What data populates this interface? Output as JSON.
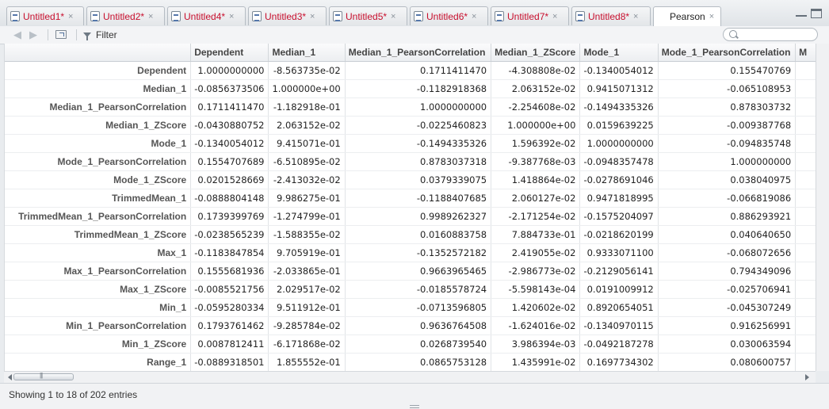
{
  "tabs": [
    {
      "label": "Untitled1*",
      "active": false
    },
    {
      "label": "Untitled2*",
      "active": false
    },
    {
      "label": "Untitled4*",
      "active": false
    },
    {
      "label": "Untitled3*",
      "active": false
    },
    {
      "label": "Untitled5*",
      "active": false
    },
    {
      "label": "Untitled6*",
      "active": false
    },
    {
      "label": "Untitled7*",
      "active": false
    },
    {
      "label": "Untitled8*",
      "active": false
    },
    {
      "label": "Pearson",
      "active": true
    }
  ],
  "tab_close_glyph": "×",
  "toolbar": {
    "back_icon": "arrow-left-icon",
    "forward_icon": "arrow-right-icon",
    "popout_icon": "show-in-new-window-icon",
    "filter_icon": "funnel-icon",
    "filter_label": "Filter",
    "search_placeholder": "",
    "search_value": ""
  },
  "table": {
    "columns": [
      "",
      "Dependent",
      "Median_1",
      "Median_1_PearsonCorrelation",
      "Median_1_ZScore",
      "Mode_1",
      "Mode_1_PearsonCorrelation",
      "M"
    ],
    "rows": [
      [
        "Dependent",
        "1.0000000000",
        "-8.563735e-02",
        "0.1711411470",
        "-4.308808e-02",
        "-0.1340054012",
        "0.155470769"
      ],
      [
        "Median_1",
        "-0.0856373506",
        "1.000000e+00",
        "-0.1182918368",
        "2.063152e-02",
        "0.9415071312",
        "-0.065108953"
      ],
      [
        "Median_1_PearsonCorrelation",
        "0.1711411470",
        "-1.182918e-01",
        "1.0000000000",
        "-2.254608e-02",
        "-0.1494335326",
        "0.878303732"
      ],
      [
        "Median_1_ZScore",
        "-0.0430880752",
        "2.063152e-02",
        "-0.0225460823",
        "1.000000e+00",
        "0.0159639225",
        "-0.009387768"
      ],
      [
        "Mode_1",
        "-0.1340054012",
        "9.415071e-01",
        "-0.1494335326",
        "1.596392e-02",
        "1.0000000000",
        "-0.094835748"
      ],
      [
        "Mode_1_PearsonCorrelation",
        "0.1554707689",
        "-6.510895e-02",
        "0.8783037318",
        "-9.387768e-03",
        "-0.0948357478",
        "1.000000000"
      ],
      [
        "Mode_1_ZScore",
        "0.0201528669",
        "-2.413032e-02",
        "0.0379339075",
        "1.418864e-02",
        "-0.0278691046",
        "0.038040975"
      ],
      [
        "TrimmedMean_1",
        "-0.0888804148",
        "9.986275e-01",
        "-0.1188407685",
        "2.060127e-02",
        "0.9471818995",
        "-0.066819086"
      ],
      [
        "TrimmedMean_1_PearsonCorrelation",
        "0.1739399769",
        "-1.274799e-01",
        "0.9989262327",
        "-2.171254e-02",
        "-0.1575204097",
        "0.886293921"
      ],
      [
        "TrimmedMean_1_ZScore",
        "-0.0238565239",
        "-1.588355e-02",
        "0.0160883758",
        "7.884733e-01",
        "-0.0218620199",
        "0.040640650"
      ],
      [
        "Max_1",
        "-0.1183847854",
        "9.705919e-01",
        "-0.1352572182",
        "2.419055e-02",
        "0.9333071100",
        "-0.068072656"
      ],
      [
        "Max_1_PearsonCorrelation",
        "0.1555681936",
        "-2.033865e-01",
        "0.9663965465",
        "-2.986773e-02",
        "-0.2129056141",
        "0.794349096"
      ],
      [
        "Max_1_ZScore",
        "-0.0085521756",
        "2.029517e-02",
        "-0.0185578724",
        "-5.598143e-04",
        "0.0191009912",
        "-0.025706941"
      ],
      [
        "Min_1",
        "-0.0595280334",
        "9.511912e-01",
        "-0.0713596805",
        "1.420602e-02",
        "0.8920654051",
        "-0.045307249"
      ],
      [
        "Min_1_PearsonCorrelation",
        "0.1793761462",
        "-9.285784e-02",
        "0.9636764508",
        "-1.624016e-02",
        "-0.1340970115",
        "0.916256991"
      ],
      [
        "Min_1_ZScore",
        "0.0087812411",
        "-6.171868e-02",
        "0.0268739540",
        "3.986394e-03",
        "-0.0492187278",
        "0.030063594"
      ],
      [
        "Range_1",
        "-0.0889318501",
        "1.855552e-01",
        "0.0865753128",
        "1.435991e-02",
        "0.1697734302",
        "0.080600757"
      ]
    ]
  },
  "footer": {
    "status": "Showing 1 to 18 of 202 entries"
  }
}
